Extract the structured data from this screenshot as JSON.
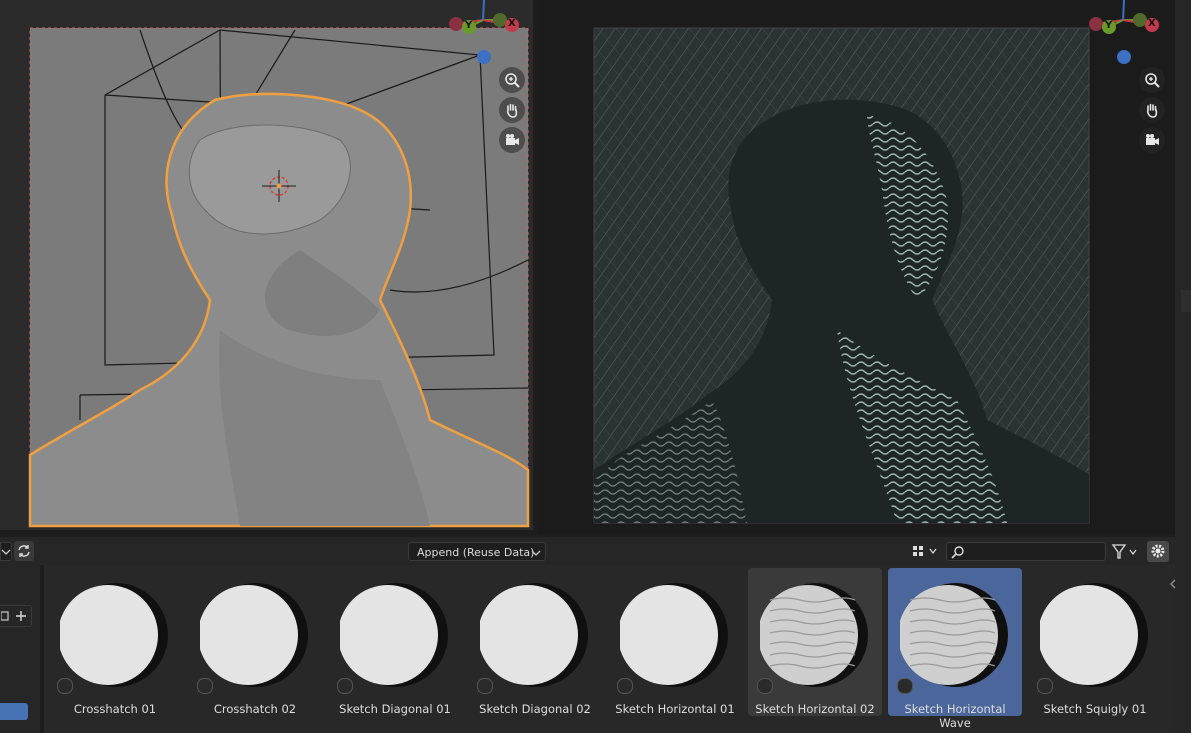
{
  "asset_browser": {
    "import_method": "Append (Reuse Data)",
    "search_placeholder": "",
    "assets": [
      {
        "name": "Crosshatch 01",
        "state": "normal"
      },
      {
        "name": "Crosshatch 02",
        "state": "normal"
      },
      {
        "name": "Sketch Diagonal 01",
        "state": "normal"
      },
      {
        "name": "Sketch Diagonal 02",
        "state": "normal"
      },
      {
        "name": "Sketch Horizontal 01",
        "state": "normal"
      },
      {
        "name": "Sketch Horizontal 02",
        "state": "hover"
      },
      {
        "name": "Sketch Horizontal Wave",
        "state": "selected"
      },
      {
        "name": "Sketch Squigly 01",
        "state": "normal"
      }
    ]
  },
  "gizmo": {
    "axis_y": "Y",
    "axis_x": "X"
  },
  "colors": {
    "selection_outline": "#f0a040",
    "axis_x": "#c23a4b",
    "axis_y": "#6a9a2a",
    "axis_z": "#3d6fc2",
    "selected_tile": "#4a669b",
    "accent": "#4772b3"
  },
  "icons": {
    "toolbar": [
      "select-box-icon",
      "cursor-icon",
      "move-icon",
      "rotate-icon",
      "scale-icon",
      "transform-icon",
      "annotate-icon",
      "measure-icon",
      "add-cube-icon",
      "extrude-icon",
      "bevel-icon"
    ],
    "navigation": [
      "zoom-icon",
      "pan-hand-icon",
      "camera-icon"
    ]
  }
}
